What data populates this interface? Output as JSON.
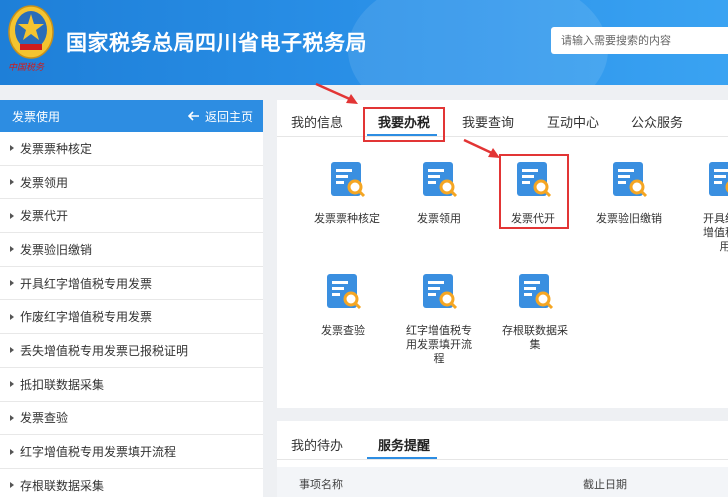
{
  "header": {
    "title": "国家税务总局四川省电子税务局",
    "emblem_caption": "中国税务",
    "search_placeholder": "请输入需要搜索的内容"
  },
  "sidebar": {
    "title": "发票使用",
    "back_label": "返回主页",
    "items": [
      {
        "label": "发票票种核定"
      },
      {
        "label": "发票领用"
      },
      {
        "label": "发票代开"
      },
      {
        "label": "发票验旧缴销"
      },
      {
        "label": "开具红字增值税专用发票"
      },
      {
        "label": "作废红字增值税专用发票"
      },
      {
        "label": "丢失增值税专用发票已报税证明"
      },
      {
        "label": "抵扣联数据采集"
      },
      {
        "label": "发票查验"
      },
      {
        "label": "红字增值税专用发票填开流程"
      },
      {
        "label": "存根联数据采集"
      }
    ]
  },
  "main": {
    "tabs": [
      {
        "label": "我的信息"
      },
      {
        "label": "我要办税"
      },
      {
        "label": "我要查询"
      },
      {
        "label": "互动中心"
      },
      {
        "label": "公众服务"
      }
    ],
    "services": [
      {
        "label": "发票票种核定"
      },
      {
        "label": "发票领用"
      },
      {
        "label": "发票代开"
      },
      {
        "label": "发票验旧缴销"
      },
      {
        "label": "开具红字增值税专用"
      },
      {
        "label": "发票查验"
      },
      {
        "label": "红字增值税专用发票填开流程"
      },
      {
        "label": "存根联数据采集"
      }
    ]
  },
  "bottom": {
    "tabs": [
      {
        "label": "我的待办"
      },
      {
        "label": "服务提醒"
      }
    ],
    "columns": [
      {
        "label": "事项名称"
      },
      {
        "label": "截止日期"
      }
    ]
  },
  "colors": {
    "brand_blue": "#2d8de2",
    "highlight_red": "#e23535",
    "icon_blue": "#3a8fe0",
    "icon_orange": "#f5a623"
  }
}
